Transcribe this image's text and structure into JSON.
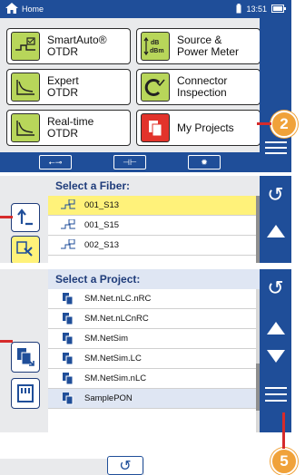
{
  "top": {
    "title": "Home",
    "time": "13:51"
  },
  "home_tiles": [
    {
      "label1": "SmartAuto®",
      "label2": "OTDR"
    },
    {
      "label1": "Source &",
      "label2": "Power Meter"
    },
    {
      "label1": "Expert",
      "label2": "OTDR"
    },
    {
      "label1": "Connector",
      "label2": "Inspection"
    },
    {
      "label1": "Real-time",
      "label2": "OTDR"
    },
    {
      "label1": "My Projects",
      "label2": ""
    }
  ],
  "fiber": {
    "header": "Select a Fiber:",
    "rows": [
      "001_S13",
      "001_S15",
      "002_S13"
    ]
  },
  "project": {
    "header": "Select a Project:",
    "rows": [
      "SM.Net.nLC.nRC",
      "SM.Net.nLCnRC",
      "SM.NetSim",
      "SM.NetSim.LC",
      "SM.NetSim.nLC",
      "SamplePON"
    ]
  },
  "callouts": {
    "a": "2",
    "b": "5"
  },
  "colors": {
    "blue": "#1f4e99",
    "green": "#b8d65a",
    "red": "#e2332b",
    "highlight": "#fff27a",
    "orange": "#f0a23a"
  }
}
